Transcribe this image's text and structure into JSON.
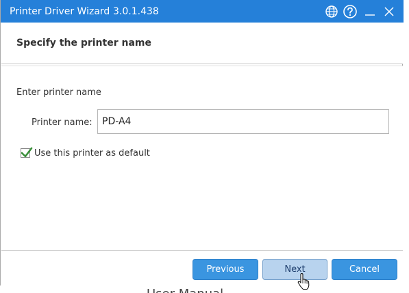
{
  "window": {
    "title": "Printer Driver Wizard",
    "version": "3.0.1.438"
  },
  "titlebar_icons": [
    "globe-icon",
    "help-icon",
    "minimize-icon",
    "close-icon"
  ],
  "header": {
    "title": "Specify the printer name"
  },
  "form": {
    "section_label": "Enter printer name",
    "printer_name_label": "Printer name:",
    "printer_name_value": "PD-A4",
    "default_checkbox_label": "Use this printer as default",
    "default_checked": true
  },
  "footer": {
    "previous_label": "Previous",
    "next_label": "Next",
    "cancel_label": "Cancel"
  },
  "colors": {
    "titlebar": "#2580d9",
    "primary_button": "#3a95e0",
    "hover_button": "#b8d3ee",
    "checkmark": "#3a8f3a"
  },
  "background_text": "User Manual"
}
